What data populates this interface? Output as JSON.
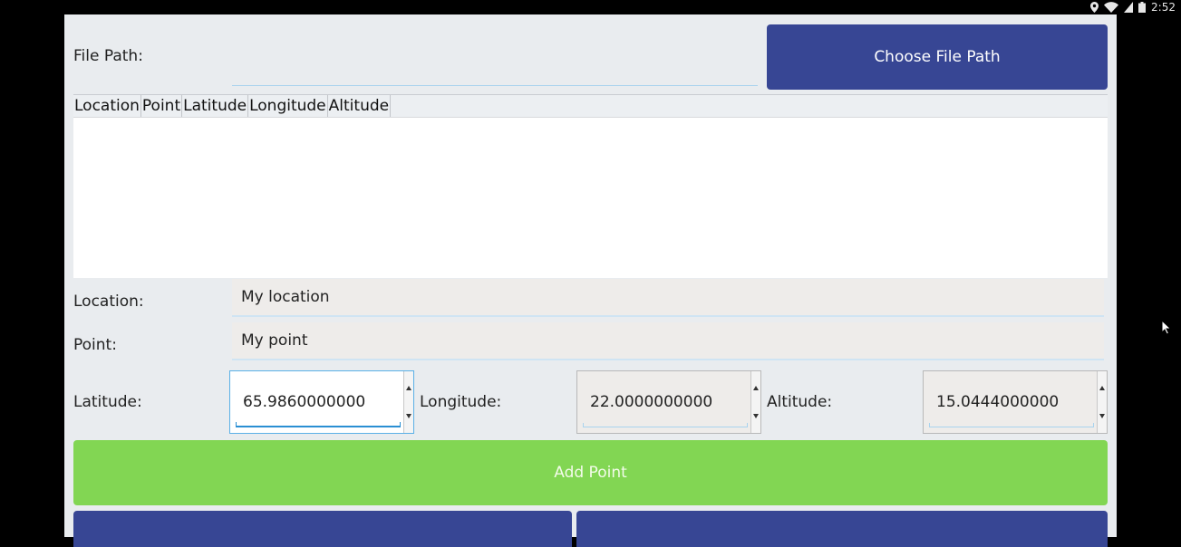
{
  "status_bar": {
    "time": "2:52",
    "icons": [
      "location-icon",
      "wifi-icon",
      "signal-icon",
      "battery-icon"
    ]
  },
  "file_path": {
    "label": "File Path:",
    "value": "",
    "button": "Choose File Path"
  },
  "table": {
    "columns": [
      "Location",
      "Point",
      "Latitude",
      "Longitude",
      "Altitude"
    ],
    "rows": []
  },
  "form": {
    "location": {
      "label": "Location:",
      "value": "My location"
    },
    "point": {
      "label": "Point:",
      "value": "My point"
    },
    "latitude": {
      "label": "Latitude:",
      "value": "65.9860000000"
    },
    "longitude": {
      "label": "Longitude:",
      "value": "22.0000000000"
    },
    "altitude": {
      "label": "Altitude:",
      "value": "15.0444000000"
    }
  },
  "add_button": "Add Point",
  "colors": {
    "primary_blue": "#374694",
    "add_green": "#82d653",
    "focus_blue": "#2a8fd3",
    "background": "#e9ecef"
  }
}
